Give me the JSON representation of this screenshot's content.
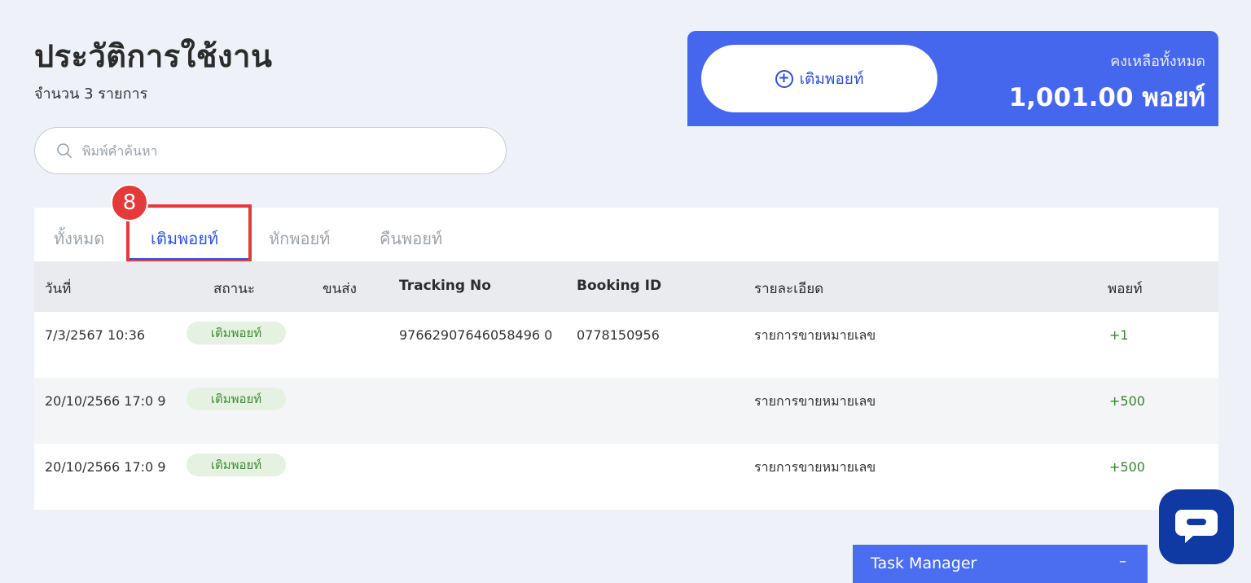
{
  "header": {
    "title": "ประวัติการใช้งาน",
    "count_text": "จำนวน 3 รายการ"
  },
  "search": {
    "placeholder": "พิมพ์คำค้นหา",
    "value": ""
  },
  "balance": {
    "topup_label": "เติมพอยท์",
    "label": "คงเหลือทั้งหมด",
    "value": "1,001.00 พอยท์"
  },
  "annotation": {
    "step_number": "8"
  },
  "tabs": [
    {
      "label": "ทั้งหมด"
    },
    {
      "label": "เติมพอยท์",
      "active": true
    },
    {
      "label": "หักพอยท์"
    },
    {
      "label": "คืนพอยท์"
    }
  ],
  "table": {
    "columns": [
      "วันที่",
      "สถานะ",
      "ขนส่ง",
      "Tracking No",
      "Booking ID",
      "รายละเอียด",
      "พอยท์"
    ],
    "rows": [
      {
        "date": "7/3/2567 10:36",
        "status": "เติมพอยท์",
        "carrier": "",
        "tracking": "97662907646058496 0",
        "booking": "0778150956",
        "detail": "รายการขายหมายเลข",
        "points": "+1"
      },
      {
        "date": "20/10/2566 17:0 9",
        "status": "เติมพอยท์",
        "carrier": "",
        "tracking": "",
        "booking": "",
        "detail": "รายการขายหมายเลข",
        "points": "+500"
      },
      {
        "date": "20/10/2566 17:0 9",
        "status": "เติมพอยท์",
        "carrier": "",
        "tracking": "",
        "booking": "",
        "detail": "รายการขายหมายเลข",
        "points": "+500"
      }
    ]
  },
  "task_manager": {
    "label": "Task Manager",
    "minimize": "–"
  },
  "colors": {
    "accent": "#4467ee",
    "highlight": "#e53a3a",
    "positive": "#2f8a2a"
  }
}
